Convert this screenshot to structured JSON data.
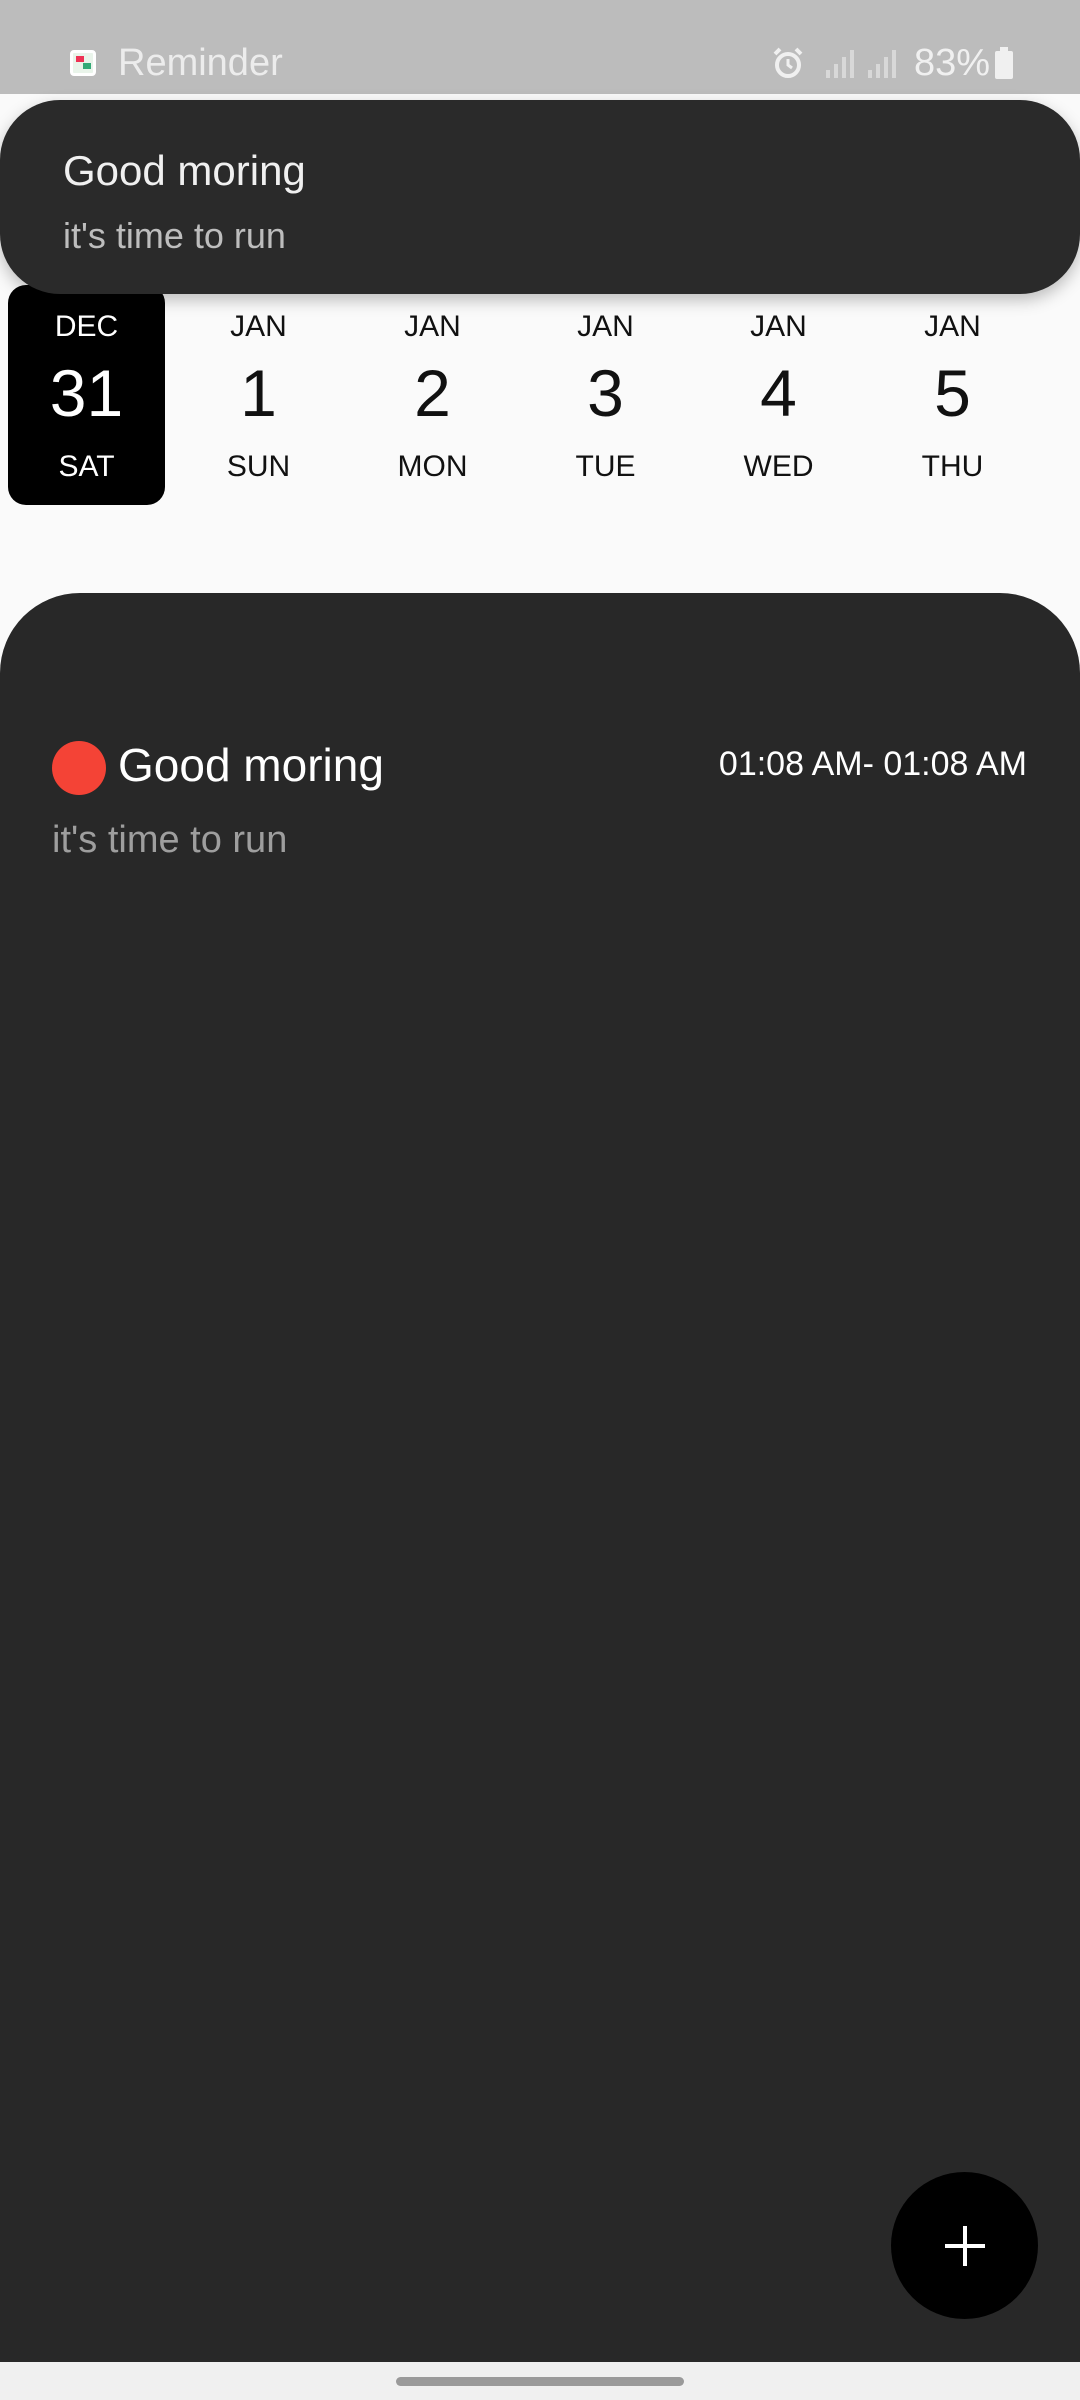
{
  "status_bar": {
    "app_name": "Reminder",
    "battery": "83%",
    "icons": [
      "app-icon",
      "alarm-icon",
      "signal-icon",
      "signal-icon",
      "battery-icon"
    ]
  },
  "notification": {
    "title": "Good moring",
    "body": "it's time to run"
  },
  "dates": [
    {
      "month": "DEC",
      "day": "31",
      "weekday": "SAT",
      "selected": true
    },
    {
      "month": "JAN",
      "day": "1",
      "weekday": "SUN",
      "selected": false
    },
    {
      "month": "JAN",
      "day": "2",
      "weekday": "MON",
      "selected": false
    },
    {
      "month": "JAN",
      "day": "3",
      "weekday": "TUE",
      "selected": false
    },
    {
      "month": "JAN",
      "day": "4",
      "weekday": "WED",
      "selected": false
    },
    {
      "month": "JAN",
      "day": "5",
      "weekday": "THU",
      "selected": false
    }
  ],
  "events": [
    {
      "title": "Good moring",
      "time": "01:08 AM- 01:08 AM",
      "description": "it's time to run",
      "color": "#f44336"
    }
  ],
  "fab": {
    "icon": "plus-icon"
  },
  "colors": {
    "panel": "#282828",
    "selected_date": "#000000",
    "event_dot": "#f44336"
  }
}
